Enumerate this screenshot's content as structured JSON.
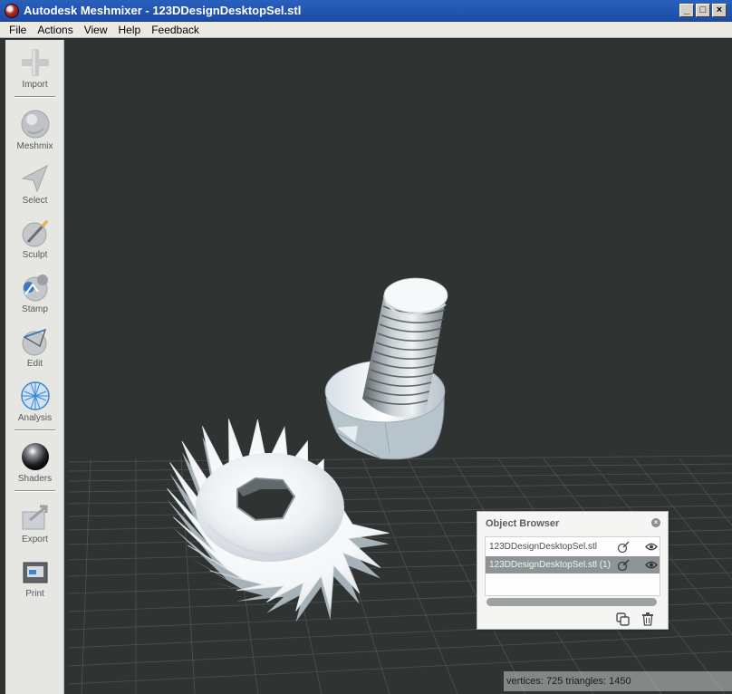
{
  "window": {
    "title": "Autodesk Meshmixer - 123DDesignDesktopSel.stl",
    "controls": [
      "_",
      "□",
      "×"
    ]
  },
  "menu": [
    "File",
    "Actions",
    "View",
    "Help",
    "Feedback"
  ],
  "toolbar": {
    "items": [
      {
        "label": "Import",
        "icon": "plus-icon"
      },
      {
        "label": "Meshmix",
        "icon": "meshmix-icon"
      },
      {
        "label": "Select",
        "icon": "select-arrow-icon"
      },
      {
        "label": "Sculpt",
        "icon": "sculpt-brush-icon"
      },
      {
        "label": "Stamp",
        "icon": "stamp-icon"
      },
      {
        "label": "Edit",
        "icon": "edit-icon"
      },
      {
        "label": "Analysis",
        "icon": "analysis-icon"
      },
      {
        "label": "Shaders",
        "icon": "shaders-sphere-icon"
      },
      {
        "label": "Export",
        "icon": "export-icon"
      },
      {
        "label": "Print",
        "icon": "print-icon"
      }
    ]
  },
  "object_browser": {
    "title": "Object Browser",
    "objects": [
      {
        "name": "123DDesignDesktopSel.stl",
        "selected": false
      },
      {
        "name": "123DDesignDesktopSel.stl (1)",
        "selected": true
      }
    ]
  },
  "status": {
    "text": "vertices: 725 triangles: 1450"
  },
  "colors": {
    "viewport_bg": "#2f3433",
    "titlebar": "#2a5fbd",
    "toolbar_bg": "#e6e6e2",
    "selected_row": "#8e9495"
  }
}
